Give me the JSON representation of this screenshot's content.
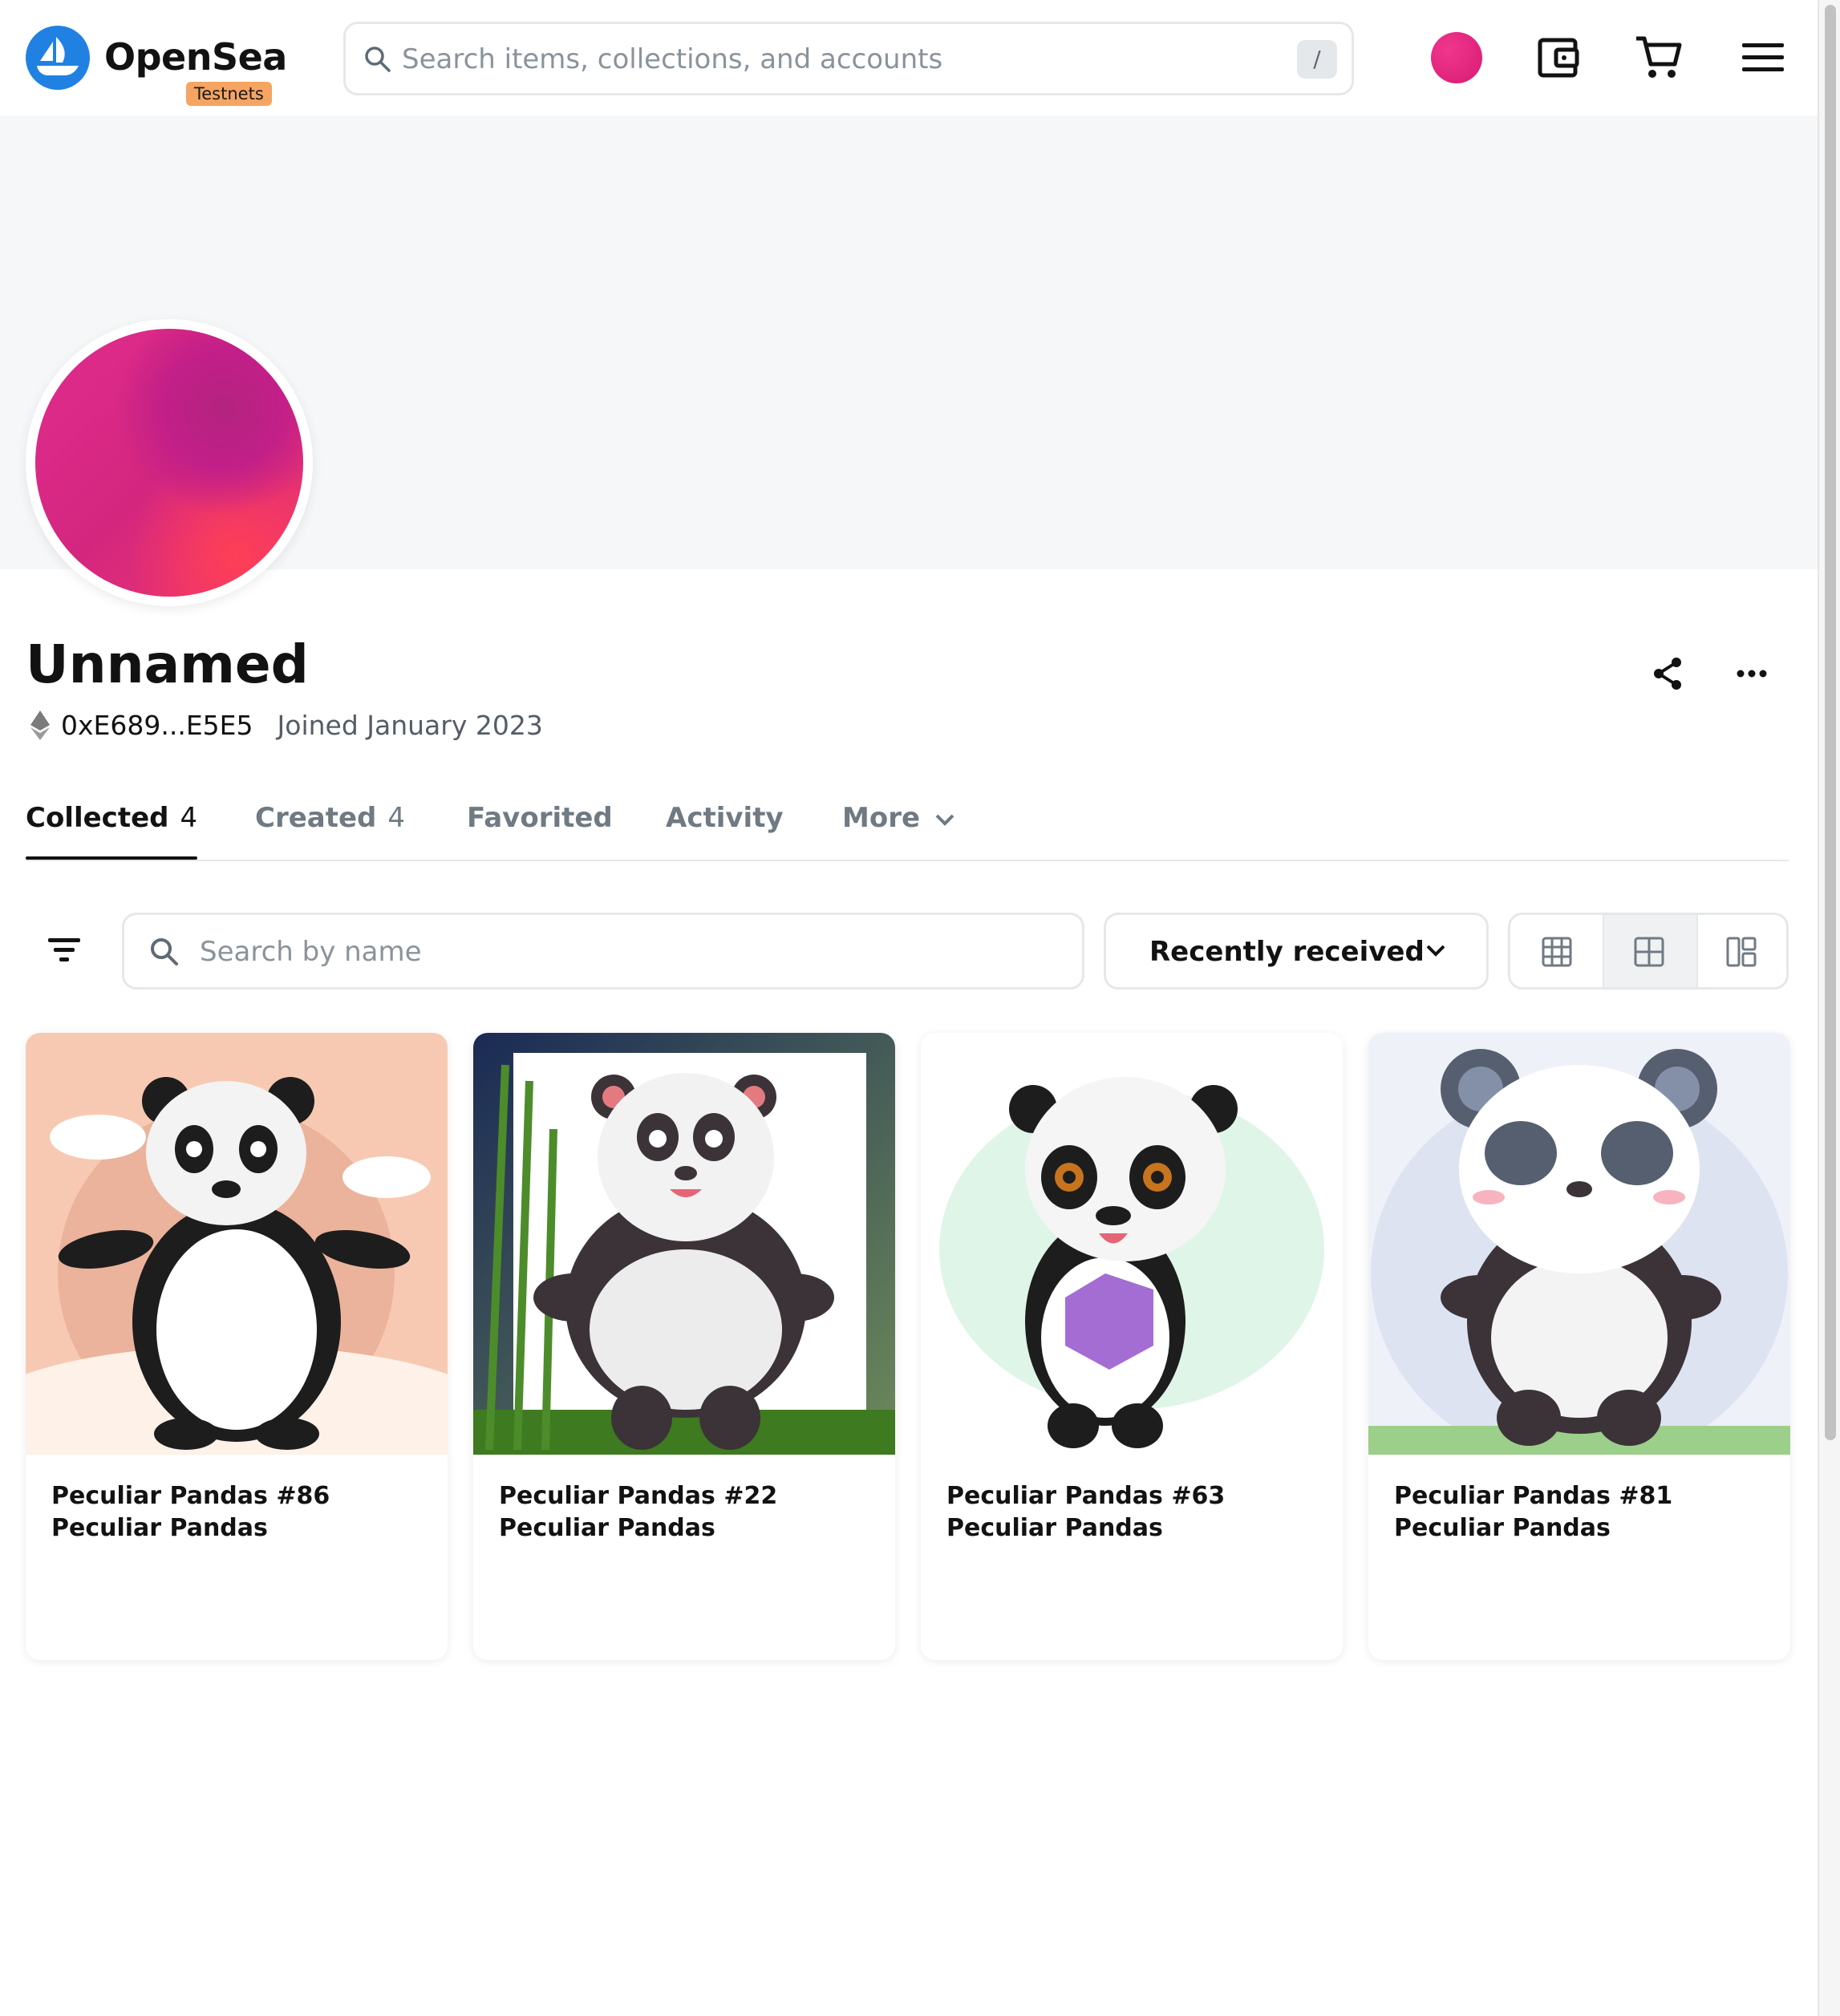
{
  "header": {
    "logo_text": "OpenSea",
    "badge": "Testnets",
    "search_placeholder": "Search items, collections, and accounts",
    "search_shortcut": "/",
    "icons": [
      "profile-avatar",
      "wallet-icon",
      "cart-icon",
      "menu-icon"
    ]
  },
  "profile": {
    "name": "Unnamed",
    "address": "0xE689...E5E5",
    "joined": "Joined January 2023",
    "actions": [
      "share-icon",
      "more-icon"
    ]
  },
  "tabs": [
    {
      "label": "Collected",
      "count": "4",
      "active": true
    },
    {
      "label": "Created",
      "count": "4",
      "active": false
    },
    {
      "label": "Favorited",
      "count": "",
      "active": false
    },
    {
      "label": "Activity",
      "count": "",
      "active": false
    },
    {
      "label": "More",
      "count": "",
      "active": false
    }
  ],
  "toolbar": {
    "search_placeholder": "Search by name",
    "sort_label": "Recently received",
    "view_modes": [
      "grid-large",
      "grid-small",
      "grid-compact"
    ],
    "selected_view": "grid-small"
  },
  "items": [
    {
      "title": "Peculiar Pandas #86",
      "collection": "Peculiar Pandas"
    },
    {
      "title": "Peculiar Pandas #22",
      "collection": "Peculiar Pandas"
    },
    {
      "title": "Peculiar Pandas #63",
      "collection": "Peculiar Pandas"
    },
    {
      "title": "Peculiar Pandas #81",
      "collection": "Peculiar Pandas"
    }
  ],
  "colors": {
    "brand": "#2081e2",
    "badge": "#f5a461",
    "avatar": "#e02c8e"
  }
}
